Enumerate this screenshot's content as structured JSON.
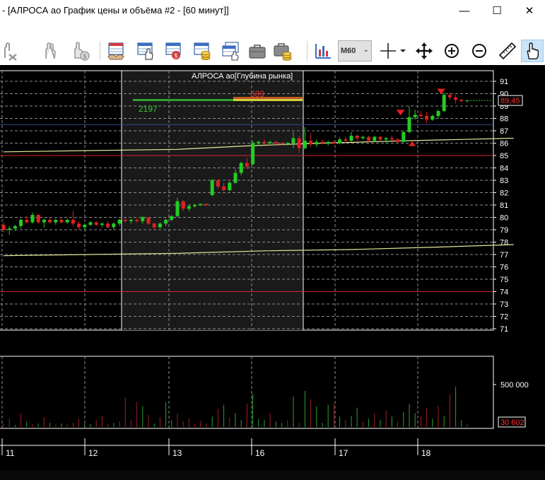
{
  "window": {
    "title": "- [АЛРОСА ао График цены и объёма #2 - [60 минут]]",
    "minimize_glyph": "—",
    "maximize_glyph": "☐",
    "close_glyph": "✕"
  },
  "mdi": {
    "minimize_glyph": "–",
    "restore_glyph": "❐",
    "close_glyph": "✕"
  },
  "toolbar": {
    "timeframe": "M60",
    "icons": [
      "hand-cross-icon",
      "hand-two-icon",
      "hand-coin-icon",
      "handshake-table-icon",
      "table-hand-icon",
      "table-ruble-icon",
      "table-coins-icon",
      "table-stack-icon",
      "briefcase-icon",
      "briefcase-coins-icon",
      "chart-type-icon",
      "crosshair-icon",
      "move-icon",
      "zoom-in-icon",
      "zoom-out-icon",
      "ruler-icon",
      "hand-pointer-icon"
    ]
  },
  "colors": {
    "background": "#000000",
    "grid": "#8c8c8c",
    "bull": "#22cc22",
    "bear": "#dd2222",
    "ma_line": "#e8e89a",
    "level_line": "#d02828",
    "depth_panel": "#1a1a1a"
  },
  "chart_data": [
    {
      "type": "candlestick",
      "title": "",
      "y_ticks": [
        "71",
        "72",
        "73",
        "74",
        "75",
        "76",
        "77",
        "78",
        "79",
        "80",
        "81",
        "82",
        "83",
        "84",
        "85",
        "86",
        "87",
        "88",
        "89",
        "90",
        "91"
      ],
      "ylim": [
        71,
        91.7
      ],
      "x_tick_labels": [
        "11",
        "12",
        "13",
        "16",
        "17",
        "18"
      ],
      "last_price_label": "89,45",
      "horizontal_levels": [
        85,
        74
      ],
      "depth_panel": {
        "title": "АЛРОСА ао[Глубина рынка]",
        "ask_volume": "689",
        "bid_volume": "2197"
      },
      "candles": [
        [
          79.4,
          79.6,
          78.8,
          79.0
        ],
        [
          79.0,
          79.3,
          78.6,
          79.1
        ],
        [
          79.1,
          79.4,
          78.9,
          79.3
        ],
        [
          79.3,
          79.9,
          79.1,
          79.8
        ],
        [
          79.8,
          80.1,
          79.5,
          79.6
        ],
        [
          79.6,
          80.4,
          79.5,
          80.2
        ],
        [
          80.2,
          80.3,
          79.5,
          79.6
        ],
        [
          79.6,
          79.9,
          79.2,
          79.8
        ],
        [
          79.8,
          80.0,
          79.5,
          79.6
        ],
        [
          79.6,
          79.9,
          79.4,
          79.8
        ],
        [
          79.8,
          80.0,
          79.5,
          79.6
        ],
        [
          79.6,
          79.9,
          79.5,
          79.8
        ],
        [
          79.8,
          80.5,
          79.3,
          79.5
        ],
        [
          79.5,
          79.7,
          79.0,
          79.2
        ],
        [
          79.2,
          79.5,
          79.0,
          79.4
        ],
        [
          79.4,
          79.7,
          79.3,
          79.6
        ],
        [
          79.6,
          79.7,
          79.3,
          79.4
        ],
        [
          79.4,
          79.6,
          79.2,
          79.5
        ],
        [
          79.5,
          79.7,
          79.1,
          79.2
        ],
        [
          79.2,
          79.6,
          79.0,
          79.5
        ],
        [
          79.5,
          79.9,
          79.3,
          79.8
        ],
        [
          79.8,
          80.0,
          79.6,
          79.7
        ],
        [
          79.7,
          79.9,
          79.5,
          79.8
        ],
        [
          79.8,
          79.9,
          79.6,
          79.7
        ],
        [
          79.7,
          80.1,
          79.5,
          80.0
        ],
        [
          80.0,
          80.0,
          79.4,
          79.5
        ],
        [
          79.5,
          79.6,
          79.0,
          79.2
        ],
        [
          79.2,
          79.6,
          79.1,
          79.5
        ],
        [
          79.5,
          79.9,
          79.3,
          79.8
        ],
        [
          79.8,
          80.2,
          79.7,
          80.1
        ],
        [
          80.1,
          81.6,
          80.0,
          81.3
        ],
        [
          81.3,
          81.4,
          80.5,
          80.7
        ],
        [
          80.7,
          81.0,
          80.5,
          80.9
        ],
        [
          80.9,
          81.1,
          80.8,
          81.0
        ],
        [
          81.0,
          81.1,
          80.9,
          81.1
        ],
        [
          81.1,
          81.1,
          80.9,
          81.0
        ],
        [
          81.8,
          83.1,
          81.7,
          83.0
        ],
        [
          83.0,
          83.1,
          82.3,
          82.5
        ],
        [
          82.5,
          82.8,
          82.1,
          82.2
        ],
        [
          82.2,
          82.9,
          82.1,
          82.8
        ],
        [
          82.8,
          83.9,
          82.7,
          83.6
        ],
        [
          83.6,
          84.5,
          83.4,
          84.4
        ],
        [
          84.4,
          84.8,
          83.9,
          84.1
        ],
        [
          84.3,
          86.2,
          84.2,
          86.0
        ],
        [
          86.0,
          86.2,
          85.8,
          86.1
        ],
        [
          86.1,
          86.3,
          85.9,
          86.0
        ],
        [
          86.0,
          86.2,
          85.9,
          86.1
        ],
        [
          86.1,
          86.2,
          85.9,
          86.0
        ],
        [
          86.0,
          86.1,
          85.8,
          85.9
        ],
        [
          85.9,
          86.1,
          85.8,
          86.0
        ],
        [
          86.0,
          86.9,
          85.6,
          86.4
        ],
        [
          86.4,
          86.6,
          85.2,
          85.6
        ],
        [
          85.6,
          87.3,
          85.5,
          86.2
        ],
        [
          86.2,
          86.8,
          85.7,
          85.9
        ],
        [
          85.9,
          86.3,
          85.7,
          86.1
        ],
        [
          86.1,
          86.3,
          85.9,
          86.0
        ],
        [
          86.0,
          86.2,
          85.8,
          86.1
        ],
        [
          86.1,
          86.2,
          85.9,
          86.0
        ],
        [
          86.0,
          86.5,
          85.9,
          86.3
        ],
        [
          86.3,
          86.5,
          85.9,
          86.2
        ],
        [
          86.2,
          86.9,
          86.1,
          86.6
        ],
        [
          86.6,
          86.7,
          86.2,
          86.4
        ],
        [
          86.4,
          86.6,
          86.3,
          86.5
        ],
        [
          86.5,
          86.6,
          86.1,
          86.2
        ],
        [
          86.2,
          86.6,
          86.1,
          86.5
        ],
        [
          86.5,
          86.6,
          86.2,
          86.3
        ],
        [
          86.3,
          86.5,
          86.0,
          86.4
        ],
        [
          86.4,
          86.6,
          86.2,
          86.3
        ],
        [
          86.3,
          86.4,
          86.0,
          86.1
        ],
        [
          86.1,
          87.0,
          86.0,
          86.9
        ],
        [
          86.9,
          89.0,
          86.8,
          88.1
        ],
        [
          88.1,
          88.7,
          87.9,
          88.3
        ],
        [
          88.3,
          88.6,
          88.1,
          88.2
        ],
        [
          88.2,
          88.5,
          87.6,
          87.9
        ],
        [
          87.9,
          88.3,
          87.8,
          88.2
        ],
        [
          88.2,
          88.7,
          88.0,
          88.6
        ],
        [
          88.6,
          90.1,
          88.5,
          89.9
        ],
        [
          89.9,
          90.1,
          89.5,
          89.7
        ],
        [
          89.7,
          89.9,
          89.2,
          89.5
        ],
        [
          89.5,
          89.6,
          89.3,
          89.4
        ],
        [
          89.4,
          89.5,
          89.3,
          89.45
        ]
      ],
      "ma_slow": [
        [
          0,
          76.9
        ],
        [
          15,
          77.0
        ],
        [
          30,
          77.1
        ],
        [
          45,
          77.3
        ],
        [
          60,
          77.4
        ],
        [
          75,
          77.6
        ],
        [
          88,
          77.8
        ]
      ],
      "ma_fast": [
        [
          0,
          85.3
        ],
        [
          15,
          85.4
        ],
        [
          30,
          85.5
        ],
        [
          43,
          85.8
        ],
        [
          55,
          86.0
        ],
        [
          70,
          86.2
        ],
        [
          88,
          86.4
        ]
      ],
      "sell_markers": [
        [
          75.5,
          90.0
        ],
        [
          68.5,
          88.3
        ]
      ],
      "buy_markers": [
        [
          70.5,
          86.1
        ]
      ]
    },
    {
      "type": "bar",
      "title": "",
      "y_ticks": [
        "500 000"
      ],
      "last_volume_label": "30 602",
      "volumes": [
        [
          0.05,
          "r"
        ],
        [
          0.12,
          "r"
        ],
        [
          0.03,
          "g"
        ],
        [
          0.2,
          "r"
        ],
        [
          0.08,
          "g"
        ],
        [
          0.04,
          "r"
        ],
        [
          0.05,
          "g"
        ],
        [
          0.14,
          "r"
        ],
        [
          0.06,
          "g"
        ],
        [
          0.03,
          "r"
        ],
        [
          0.05,
          "g"
        ],
        [
          0.04,
          "r"
        ],
        [
          0.06,
          "r"
        ],
        [
          0.12,
          "r"
        ],
        [
          0.05,
          "g"
        ],
        [
          0.04,
          "g"
        ],
        [
          0.1,
          "r"
        ],
        [
          0.16,
          "r"
        ],
        [
          0.04,
          "r"
        ],
        [
          0.06,
          "g"
        ],
        [
          0.08,
          "r"
        ],
        [
          0.43,
          "r"
        ],
        [
          0.1,
          "r"
        ],
        [
          0.36,
          "r"
        ],
        [
          0.3,
          "g"
        ],
        [
          0.18,
          "r"
        ],
        [
          0.05,
          "g"
        ],
        [
          0.14,
          "r"
        ],
        [
          0.36,
          "g"
        ],
        [
          0.1,
          "g"
        ],
        [
          0.2,
          "r"
        ],
        [
          0.08,
          "r"
        ],
        [
          0.12,
          "r"
        ],
        [
          0.05,
          "r"
        ],
        [
          0.09,
          "r"
        ],
        [
          0.05,
          "r"
        ],
        [
          0.15,
          "g"
        ],
        [
          0.26,
          "r"
        ],
        [
          0.32,
          "g"
        ],
        [
          0.14,
          "r"
        ],
        [
          0.2,
          "g"
        ],
        [
          0.1,
          "g"
        ],
        [
          0.34,
          "r"
        ],
        [
          0.48,
          "g"
        ],
        [
          0.12,
          "g"
        ],
        [
          0.1,
          "g"
        ],
        [
          0.2,
          "r"
        ],
        [
          0.08,
          "g"
        ],
        [
          0.06,
          "g"
        ],
        [
          0.1,
          "r"
        ],
        [
          0.44,
          "g"
        ],
        [
          0.06,
          "r"
        ],
        [
          0.52,
          "g"
        ],
        [
          0.4,
          "r"
        ],
        [
          0.3,
          "g"
        ],
        [
          0.06,
          "g"
        ],
        [
          0.32,
          "g"
        ],
        [
          0.34,
          "r"
        ],
        [
          0.15,
          "g"
        ],
        [
          0.1,
          "r"
        ],
        [
          0.16,
          "g"
        ],
        [
          0.28,
          "g"
        ],
        [
          0.08,
          "r"
        ],
        [
          0.12,
          "g"
        ],
        [
          0.2,
          "r"
        ],
        [
          0.1,
          "g"
        ],
        [
          0.24,
          "r"
        ],
        [
          0.15,
          "g"
        ],
        [
          0.08,
          "r"
        ],
        [
          0.22,
          "g"
        ],
        [
          0.33,
          "g"
        ],
        [
          0.2,
          "g"
        ],
        [
          0.16,
          "r"
        ],
        [
          0.28,
          "r"
        ],
        [
          0.12,
          "g"
        ],
        [
          0.3,
          "r"
        ],
        [
          0.16,
          "g"
        ],
        [
          0.47,
          "r"
        ],
        [
          0.58,
          "g"
        ],
        [
          0.1,
          "g"
        ],
        [
          0.05,
          "r"
        ]
      ]
    }
  ]
}
